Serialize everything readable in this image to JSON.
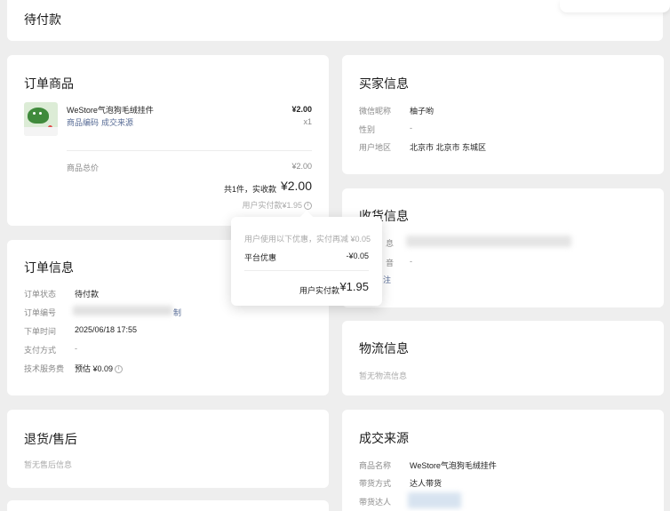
{
  "header": {
    "title": "待付款"
  },
  "order_goods": {
    "title": "订单商品",
    "product": {
      "name": "WeStore气泡狗毛绒挂件",
      "price": "¥2.00",
      "qty": "x1",
      "code_link": "商品编码",
      "source_link": "成交来源"
    },
    "subtotal_label": "商品总价",
    "subtotal_value": "¥2.00",
    "paid_summary": "共1件，实收款",
    "paid_amount": "¥2.00",
    "user_paid": "用户实付款¥1.95"
  },
  "popover": {
    "hint": "用户使用以下优惠，实付再减 ¥0.05",
    "discount_label": "平台优惠",
    "discount_value": "-¥0.05",
    "total_label": "用户实付款",
    "total_value": "¥1.95"
  },
  "order_info": {
    "title": "订单信息",
    "status_label": "订单状态",
    "status_value": "待付款",
    "number_label": "订单编号",
    "copy_label": "制",
    "time_label": "下单时间",
    "time_value": "2025/06/18 17:55",
    "pay_label": "支付方式",
    "pay_value": "-",
    "fee_label": "技术服务费",
    "fee_value": "预估 ¥0.09"
  },
  "refund": {
    "title": "退货/售后",
    "empty": "暂无售后信息"
  },
  "buyer": {
    "title": "买家信息",
    "nick_label": "微信昵称",
    "nick_value": "柚子哟",
    "gender_label": "性别",
    "gender_value": "-",
    "region_label": "用户地区",
    "region_value": "北京市 北京市 东城区"
  },
  "shipping": {
    "title": "收货信息",
    "frag1": "息",
    "frag2": "音",
    "frag2_value": "-",
    "frag3": "注"
  },
  "logistics": {
    "title": "物流信息",
    "empty": "暂无物流信息"
  },
  "source": {
    "title": "成交来源",
    "name_label": "商品名称",
    "name_value": "WeStore气泡狗毛绒挂件",
    "mode_label": "带货方式",
    "mode_value": "达人带货",
    "talent_label": "带货达人"
  },
  "colors": {
    "link": "#576b95",
    "bg": "#eeeeee",
    "card": "#ffffff"
  },
  "icons": [
    "info-icon",
    "product-thumbnail"
  ]
}
